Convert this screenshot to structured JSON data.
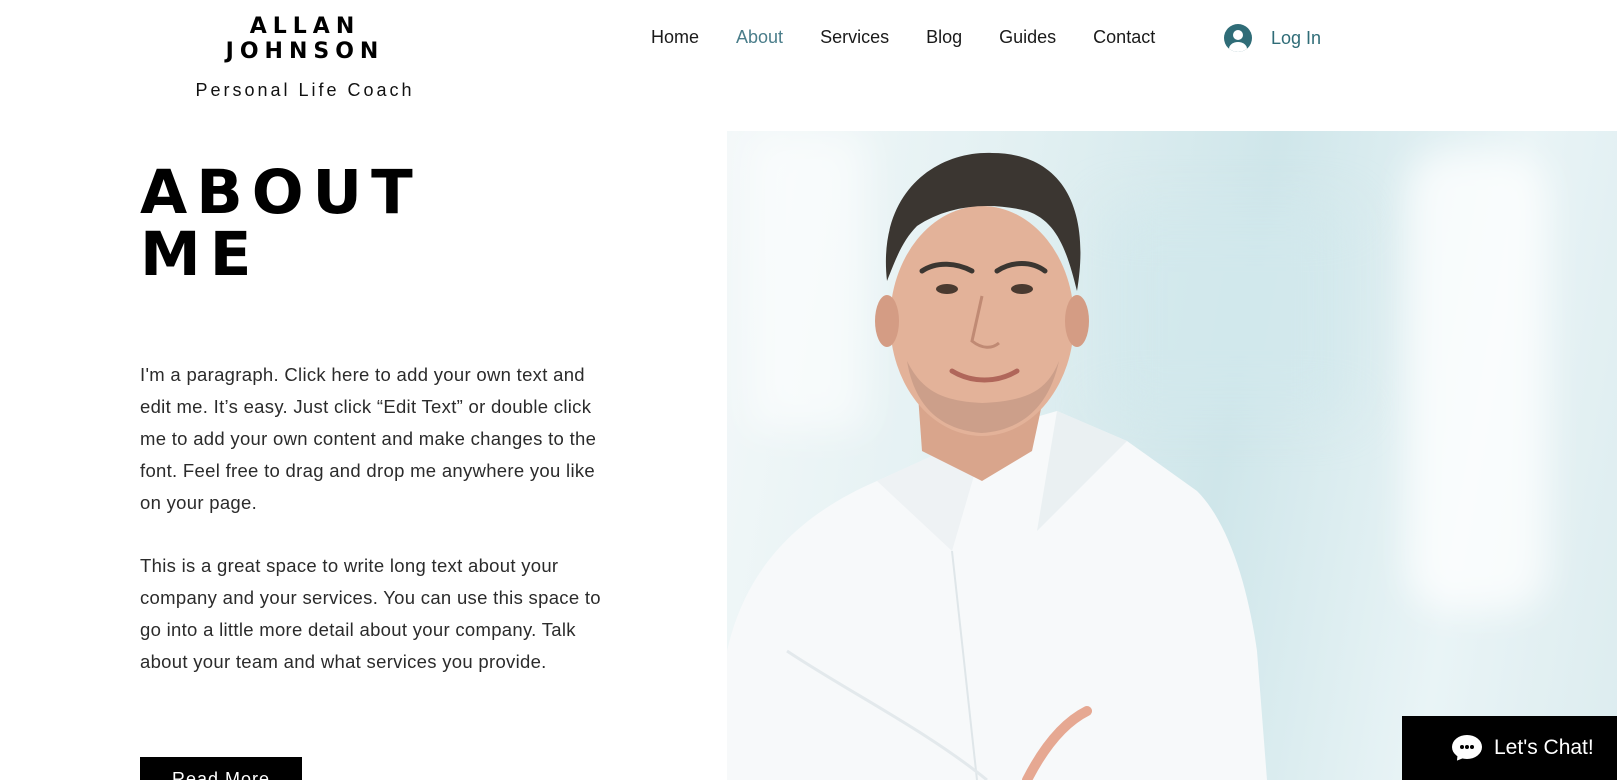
{
  "brand": {
    "name": "ALLAN JOHNSON",
    "tagline": "Personal Life Coach"
  },
  "nav": {
    "items": [
      "Home",
      "About",
      "Services",
      "Blog",
      "Guides",
      "Contact"
    ],
    "active": "About"
  },
  "login": {
    "label": "Log In",
    "icon": "user-avatar-icon"
  },
  "about": {
    "heading_line1": "ABOUT",
    "heading_line2": "ME",
    "paragraph1": "I'm a paragraph. Click here to add your own text and edit me. It’s easy. Just click “Edit Text” or double click me to add your own content and make changes to the font. Feel free to drag and drop me anywhere you like on your page.",
    "paragraph2": "This is a great space to write long text about your company and your services. You can use this space to go into a little more detail about your company. Talk about your team and what services you provide.",
    "button_label": "Read More"
  },
  "chat": {
    "label": "Let's Chat!",
    "icon": "chat-bubble-icon"
  },
  "colors": {
    "accent": "#2f6c77",
    "nav_active": "#4a7d8a",
    "text": "#2b2b2b",
    "button_bg": "#000000"
  }
}
